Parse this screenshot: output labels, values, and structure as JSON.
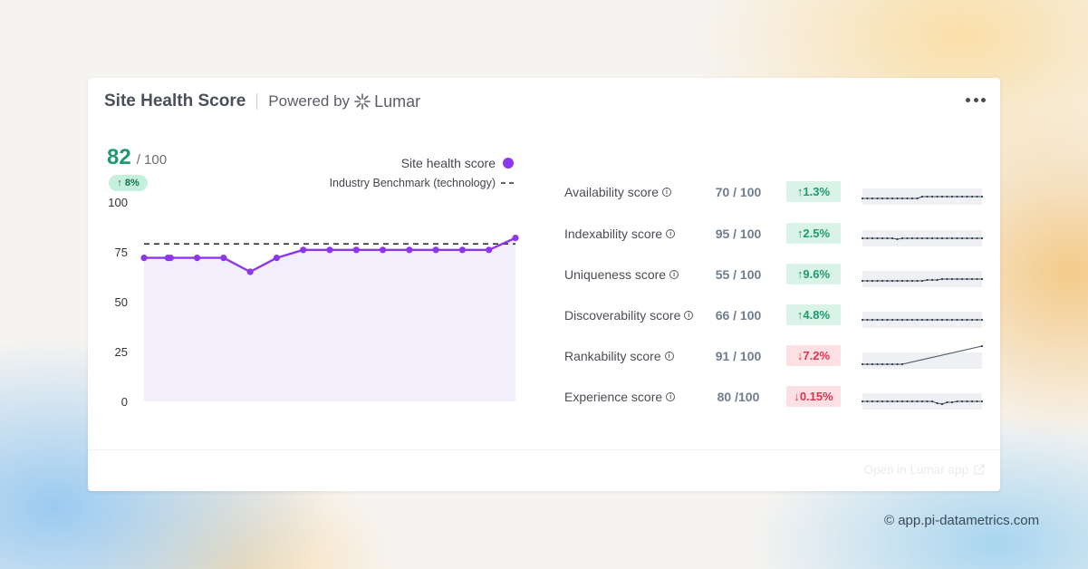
{
  "header": {
    "title": "Site Health Score",
    "powered_by": "Powered by",
    "brand": "Lumar"
  },
  "score": {
    "value": "82",
    "max": "/ 100",
    "change": "↑ 8%"
  },
  "legend": {
    "series": "Site health score",
    "benchmark": "Industry Benchmark (technology)"
  },
  "colors": {
    "series": "#8d37eb",
    "area": "#f3eefc",
    "benchmark": "#333333",
    "positive": "#1f9a6f",
    "negative": "#e0334b"
  },
  "chart_data": {
    "type": "area",
    "y_ticks": [
      "100",
      "75",
      "50",
      "25",
      "0"
    ],
    "ylim": [
      0,
      100
    ],
    "series": [
      {
        "values": [
          72,
          72,
          72,
          72,
          72,
          65,
          72,
          76,
          76,
          76,
          76,
          76,
          76,
          76,
          76,
          82
        ]
      }
    ],
    "x_positions": [
      0,
      0.9,
      1,
      2,
      3,
      4,
      5,
      6,
      7,
      8,
      9,
      10,
      11,
      12,
      13,
      14
    ],
    "benchmark": 79,
    "grid": false,
    "legend": "top-right"
  },
  "metrics": [
    {
      "label": "Availability score",
      "score": "70 / 100",
      "change": "↑1.3%",
      "direction": "up",
      "trend": [
        4,
        4,
        4,
        4,
        4,
        4,
        4,
        4,
        4,
        4,
        4,
        4,
        6,
        6,
        6,
        6,
        6,
        6,
        6,
        6,
        6,
        6,
        6,
        6,
        6
      ]
    },
    {
      "label": "Indexability score",
      "score": "95 / 100",
      "change": "↑2.5%",
      "direction": "up",
      "trend": [
        6,
        6,
        6,
        6,
        6,
        6,
        6,
        5,
        6,
        6,
        6,
        6,
        6,
        6,
        6,
        6,
        6,
        6,
        6,
        6,
        6,
        6,
        6,
        6,
        6
      ]
    },
    {
      "label": "Uniqueness score",
      "score": "55 / 100",
      "change": "↑9.6%",
      "direction": "up",
      "trend": [
        4,
        4,
        4,
        4,
        4,
        4,
        4,
        4,
        4,
        4,
        4,
        4,
        4,
        5,
        5,
        5,
        6,
        6,
        6,
        6,
        6,
        6,
        6,
        6,
        6
      ]
    },
    {
      "label": "Discoverability score",
      "score": "66 / 100",
      "change": "↑4.8%",
      "direction": "up",
      "trend": [
        6,
        6,
        6,
        6,
        6,
        6,
        6,
        6,
        6,
        6,
        6,
        6,
        6,
        6,
        6,
        6,
        6,
        6,
        6,
        6,
        6,
        6,
        6,
        6,
        6
      ]
    },
    {
      "label": "Rankability score",
      "score": "91 / 100",
      "change": "↓7.2%",
      "direction": "down",
      "trend": [
        2,
        2,
        2,
        2,
        2,
        2,
        2,
        2,
        2,
        null,
        null,
        null,
        null,
        null,
        null,
        null,
        null,
        null,
        null,
        null,
        null,
        null,
        null,
        null,
        22
      ]
    },
    {
      "label": "Experience score",
      "score": "80 /100",
      "change": "↓0.15%",
      "direction": "down",
      "trend": [
        6,
        6,
        6,
        6,
        6,
        6,
        6,
        6,
        6,
        6,
        6,
        6,
        6,
        6,
        6,
        4,
        3,
        5,
        5,
        6,
        6,
        6,
        6,
        6,
        6
      ]
    }
  ],
  "footer": {
    "open_app": "Open in Lumar app"
  },
  "copyright": "© app.pi-datametrics.com"
}
